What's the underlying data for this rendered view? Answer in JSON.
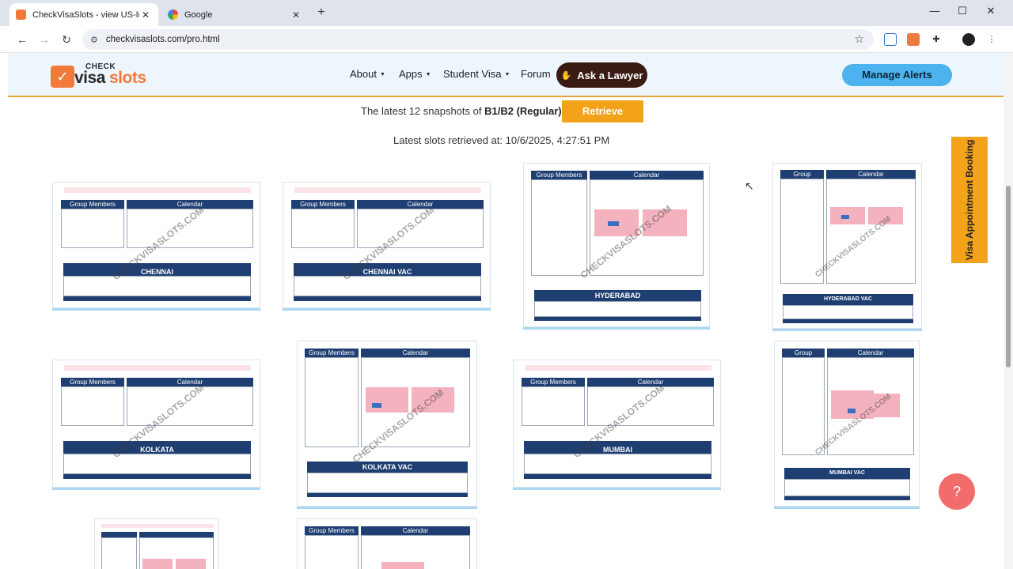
{
  "browser": {
    "tabs": [
      {
        "title": "CheckVisaSlots - view US-India",
        "close": "✕"
      },
      {
        "title": "Google",
        "close": "✕"
      }
    ],
    "new_tab": "+",
    "url": "checkvisaslots.com/pro.html"
  },
  "header": {
    "logo": {
      "check": "CHECK",
      "visa": "visa",
      "slots": "slots"
    },
    "nav": [
      {
        "label": "About",
        "caret": "▼"
      },
      {
        "label": "Apps",
        "caret": "▼"
      },
      {
        "label": "Student Visa",
        "caret": "▼"
      },
      {
        "label": "Forum",
        "caret": ""
      }
    ],
    "ask_lawyer": "Ask a Lawyer",
    "manage_alerts": "Manage Alerts"
  },
  "main": {
    "snapshot_prefix": "The latest 12 snapshots of ",
    "visa_type": "B1/B2 (Regular)",
    "retrieve": "Retrieve",
    "retrieved_at": "Latest slots retrieved at: 10/6/2025, 4:27:51 PM"
  },
  "snapshots": {
    "group_members": "Group Members",
    "calendar": "Calendar",
    "watermark": "CHECKVISASLOTS.COM",
    "cities": [
      "CHENNAI",
      "CHENNAI VAC",
      "HYDERABAD",
      "HYDERABAD VAC",
      "KOLKATA",
      "KOLKATA VAC",
      "MUMBAI",
      "MUMBAI VAC"
    ]
  },
  "side_tab": "Visa Appointment Booking",
  "help": "?"
}
